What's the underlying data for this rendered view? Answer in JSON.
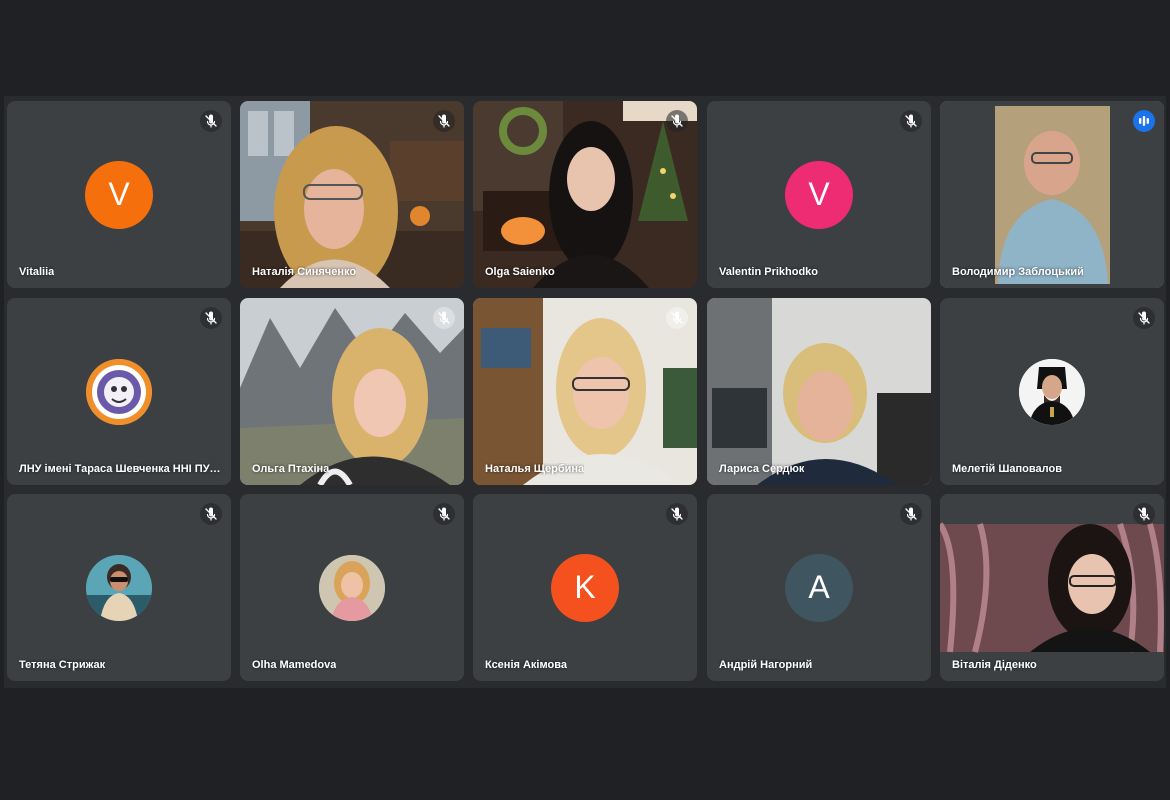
{
  "participants": [
    {
      "name": "Vitaliia",
      "initial": "V",
      "color": "#f56f0c",
      "mic": "muted"
    },
    {
      "name": "Наталія Синяченко",
      "mic": "muted"
    },
    {
      "name": "Olga Saienko",
      "mic": "muted"
    },
    {
      "name": "Valentin Prikhodko",
      "initial": "V",
      "color": "#ee2c74",
      "mic": "muted"
    },
    {
      "name": "Володимир Заблоцький",
      "mic": "speaking"
    },
    {
      "name": "ЛНУ імені Тараса Шевченка ННІ ПУП...",
      "mic": "muted"
    },
    {
      "name": "Ольга Птахіна",
      "mic": "muted"
    },
    {
      "name": "Наталья Щербина",
      "mic": "muted"
    },
    {
      "name": "Лариса Сердюк"
    },
    {
      "name": "Мелетій Шаповалов",
      "mic": "muted"
    },
    {
      "name": "Тетяна Стрижак",
      "mic": "muted"
    },
    {
      "name": "Olha Mamedova",
      "mic": "muted"
    },
    {
      "name": "Ксенія Акімова",
      "initial": "K",
      "color": "#f4511e",
      "mic": "muted"
    },
    {
      "name": "Андрій Нагорний",
      "initial": "A",
      "color": "#3f5560",
      "mic": "muted"
    },
    {
      "name": "Віталія Діденко",
      "mic": "muted"
    }
  ],
  "colors": {
    "background": "#202124",
    "tile": "#3c4043",
    "active_speaker": "#8ab4f8"
  }
}
